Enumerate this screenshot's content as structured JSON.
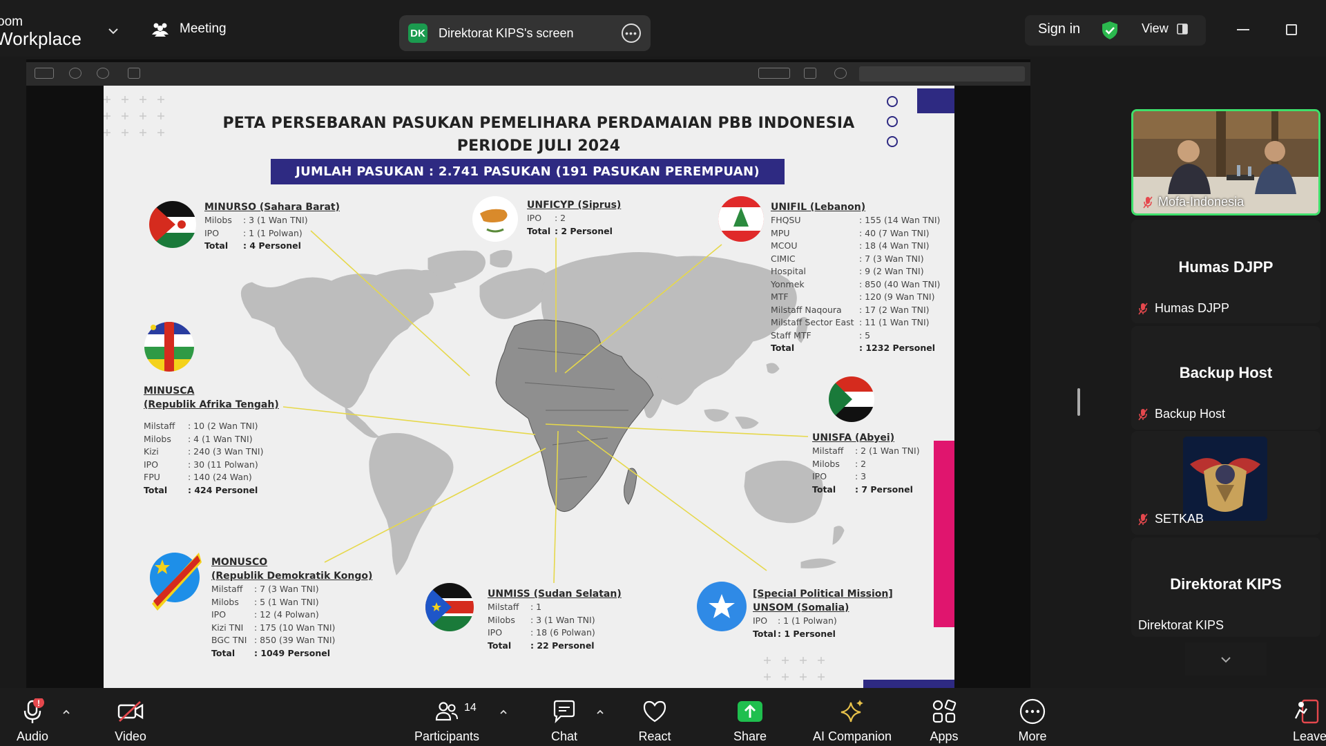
{
  "app": {
    "brand_line1": "oom",
    "brand_line2": "Workplace",
    "meeting_label": "Meeting",
    "share_badge": "DK",
    "share_text": "Direktorat KIPS's screen",
    "sign_in": "Sign in",
    "view": "View"
  },
  "slide": {
    "title_line1": "PETA PERSEBARAN PASUKAN PEMELIHARA PERDAMAIAN PBB INDONESIA",
    "title_line2": "PERIODE JULI 2024",
    "total_bar": "JUMLAH PASUKAN : 2.741 PASUKAN (191 PASUKAN PEREMPUAN)",
    "missions": {
      "minurso": {
        "title": "MINURSO (Sahara Barat)",
        "rows": [
          {
            "k": "Milobs",
            "v": ": 3 (1 Wan TNI)"
          },
          {
            "k": "IPO",
            "v": ": 1 (1 Polwan)"
          }
        ],
        "total": {
          "k": "Total",
          "v": ": 4 Personel"
        }
      },
      "unficyp": {
        "title": "UNFICYP (Siprus)",
        "rows": [
          {
            "k": "IPO",
            "v": ": 2"
          }
        ],
        "total": {
          "k": "Total",
          "v": ": 2 Personel"
        }
      },
      "unifil": {
        "title": "UNIFIL (Lebanon)",
        "rows": [
          {
            "k": "FHQSU",
            "v": ": 155 (14 Wan TNI)"
          },
          {
            "k": "MPU",
            "v": ": 40 (7 Wan TNI)"
          },
          {
            "k": "MCOU",
            "v": ": 18 (4 Wan TNI)"
          },
          {
            "k": "CIMIC",
            "v": ": 7 (3 Wan TNI)"
          },
          {
            "k": "Hospital",
            "v": ": 9 (2 Wan TNI)"
          },
          {
            "k": "Yonmek",
            "v": ": 850 (40 Wan TNI)"
          },
          {
            "k": "MTF",
            "v": ": 120 (9 Wan TNI)"
          },
          {
            "k": "Milstaff Naqoura",
            "v": ": 17 (2 Wan TNI)"
          },
          {
            "k": "Milstaff Sector East",
            "v": ": 11 (1 Wan TNI)"
          },
          {
            "k": "Staff MTF",
            "v": ": 5"
          }
        ],
        "total": {
          "k": "Total",
          "v": ": 1232 Personel"
        }
      },
      "minusca": {
        "title": "MINUSCA",
        "subtitle": "(Republik Afrika Tengah)",
        "rows": [
          {
            "k": "Milstaff",
            "v": ": 10 (2 Wan TNI)"
          },
          {
            "k": "Milobs",
            "v": ": 4 (1 Wan TNI)"
          },
          {
            "k": "Kizi",
            "v": ": 240 (3 Wan TNI)"
          },
          {
            "k": "IPO",
            "v": ": 30 (11 Polwan)"
          },
          {
            "k": "FPU",
            "v": ": 140 (24 Wan)"
          }
        ],
        "total": {
          "k": "Total",
          "v": ": 424 Personel"
        }
      },
      "unisfa": {
        "title": "UNISFA (Abyei)",
        "rows": [
          {
            "k": "Milstaff",
            "v": ": 2 (1 Wan TNI)"
          },
          {
            "k": "Milobs",
            "v": ": 2"
          },
          {
            "k": "IPO",
            "v": ": 3"
          }
        ],
        "total": {
          "k": "Total",
          "v": ": 7 Personel"
        }
      },
      "monusco": {
        "title": "MONUSCO",
        "subtitle": "(Republik Demokratik Kongo)",
        "rows": [
          {
            "k": "Milstaff",
            "v": ": 7 (3 Wan TNI)"
          },
          {
            "k": "Milobs",
            "v": ": 5 (1 Wan TNI)"
          },
          {
            "k": "IPO",
            "v": ": 12 (4 Polwan)"
          },
          {
            "k": "Kizi TNI",
            "v": ": 175 (10 Wan TNI)"
          },
          {
            "k": "BGC TNI",
            "v": ": 850 (39 Wan TNI)"
          }
        ],
        "total": {
          "k": "Total",
          "v": ": 1049 Personel"
        }
      },
      "unmiss": {
        "title": "UNMISS (Sudan Selatan)",
        "rows": [
          {
            "k": "Milstaff",
            "v": ": 1"
          },
          {
            "k": "Milobs",
            "v": ": 3 (1 Wan TNI)"
          },
          {
            "k": "IPO",
            "v": ": 18 (6 Polwan)"
          }
        ],
        "total": {
          "k": "Total",
          "v": ": 22 Personel"
        }
      },
      "unsom": {
        "title": "[Special Political Mission]",
        "subtitle": "UNSOM (Somalia)",
        "rows": [
          {
            "k": "IPO",
            "v": ": 1 (1 Polwan)"
          }
        ],
        "total": {
          "k": "Total",
          "v": ": 1 Personel"
        }
      }
    }
  },
  "panel": {
    "tile1_name": "Mofa-Indonesia",
    "humas_big": "Humas DJPP",
    "humas_name": "Humas DJPP",
    "backup_big": "Backup Host",
    "backup_name": "Backup Host",
    "setkab_name": "SETKAB",
    "kips_big": "Direktorat KIPS",
    "kips_name": "Direktorat KIPS"
  },
  "toolbar": {
    "audio": "Audio",
    "video": "Video",
    "participants": "Participants",
    "participants_count": "14",
    "chat": "Chat",
    "react": "React",
    "share": "Share",
    "ai_companion": "AI Companion",
    "apps": "Apps",
    "more": "More",
    "leave": "Leave",
    "audio_badge": "!"
  },
  "colors": {
    "accent_green": "#3ee06b",
    "share_green": "#1b9b4f",
    "navy_bar": "#2e2a82",
    "magenta": "#e0156e",
    "mic_red": "#e5484d"
  },
  "icons": [
    "chevron-down-icon",
    "meeting-people-icon",
    "more-dots-icon",
    "shield-check-icon",
    "view-grid-icon",
    "minimize-icon",
    "maximize-icon",
    "mic-off-icon",
    "mic-icon",
    "video-off-icon",
    "participants-icon",
    "chat-icon",
    "heart-icon",
    "share-arrow-icon",
    "sparkle-icon",
    "apps-icon",
    "more-icon",
    "leave-icon"
  ]
}
